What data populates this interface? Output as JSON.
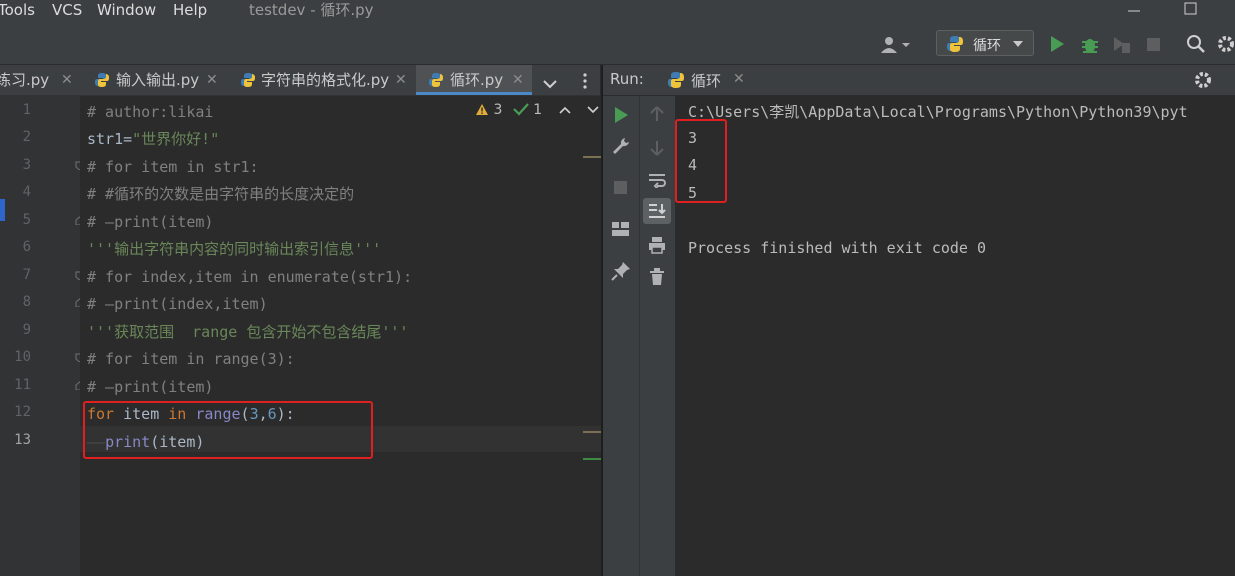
{
  "menu": {
    "items": [
      {
        "label": "Tools",
        "u": "T"
      },
      {
        "label": "VCS",
        "u": ""
      },
      {
        "label": "Window",
        "u": "W"
      },
      {
        "label": "Help",
        "u": "H"
      }
    ],
    "window_title": "testdev - 循环.py"
  },
  "toolbar": {
    "run_config": "循环"
  },
  "tabs": [
    {
      "label": "练习.py",
      "active": false
    },
    {
      "label": "输入输出.py",
      "active": false
    },
    {
      "label": "字符串的格式化.py",
      "active": false
    },
    {
      "label": "循环.py",
      "active": true
    }
  ],
  "editor": {
    "warnings": "3",
    "ok": "1",
    "line_numbers": [
      "1",
      "2",
      "3",
      "4",
      "5",
      "6",
      "7",
      "8",
      "9",
      "10",
      "11",
      "12",
      "13"
    ],
    "current_line": "13",
    "lines": [
      "# author:likai",
      "str1=\"世界你好!\"",
      "# for item in str1:",
      "# #循环的次数是由字符串的长度决定的",
      "# —print(item)",
      "'''输出字符串内容的同时输出索引信息'''",
      "# for index,item in enumerate(str1):",
      "# —print(index,item)",
      "'''获取范围  range 包含开始不包含结尾'''",
      "# for item in range(3):",
      "# —print(item)",
      "for item in range(3,6):",
      "——print(item)"
    ]
  },
  "run": {
    "label": "Run:",
    "tab": "循环",
    "output": [
      "C:\\Users\\李凯\\AppData\\Local\\Programs\\Python\\Python39\\pyt",
      "3",
      "4",
      "5",
      "",
      "Process finished with exit code 0"
    ]
  },
  "colors": {
    "highlight": "#e02020",
    "run_green": "#499c54",
    "keyword": "#cc7832",
    "comment": "#808080",
    "string": "#6a8759"
  }
}
